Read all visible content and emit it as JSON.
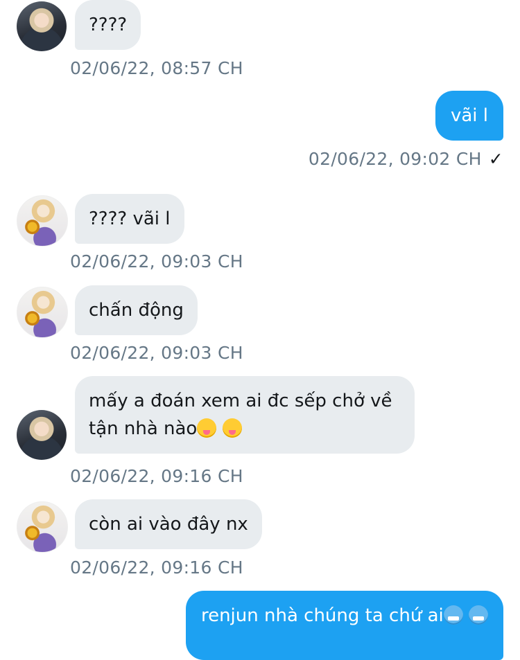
{
  "messages": [
    {
      "id": "m1",
      "direction": "in",
      "avatar_icon": "user-avatar-icon",
      "text": "????",
      "timestamp": "02/06/22, 08:57 CH"
    },
    {
      "id": "m2",
      "direction": "out",
      "text": "vãi l",
      "timestamp": "02/06/22, 09:02 CH",
      "status_icon": "✓"
    },
    {
      "id": "m3",
      "direction": "in",
      "avatar_icon": "user-avatar-icon",
      "text": "???? vãi l",
      "timestamp": "02/06/22, 09:03 CH"
    },
    {
      "id": "m4",
      "direction": "in",
      "avatar_icon": "user-avatar-icon",
      "text": "chấn động",
      "timestamp": "02/06/22, 09:03 CH"
    },
    {
      "id": "m5",
      "direction": "in",
      "avatar_icon": "user-avatar-icon",
      "text_line1": "mấy a đoán xem ai đc sếp chở về",
      "text_line2": "tận nhà nào",
      "emojis": [
        "zany-face-emoji",
        "zany-face-emoji"
      ],
      "timestamp": "02/06/22, 09:16 CH"
    },
    {
      "id": "m6",
      "direction": "in",
      "avatar_icon": "user-avatar-icon",
      "text": "còn ai vào đây nx",
      "timestamp": "02/06/22, 09:16 CH"
    },
    {
      "id": "m7",
      "direction": "out",
      "text": "renjun nhà chúng ta chứ ai",
      "emojis": [
        "cold-face-emoji",
        "cold-face-emoji"
      ]
    }
  ],
  "colors": {
    "incoming_bubble": "#e8ecef",
    "outgoing_bubble": "#1da1f2",
    "timestamp": "#657786",
    "text": "#14171a"
  }
}
